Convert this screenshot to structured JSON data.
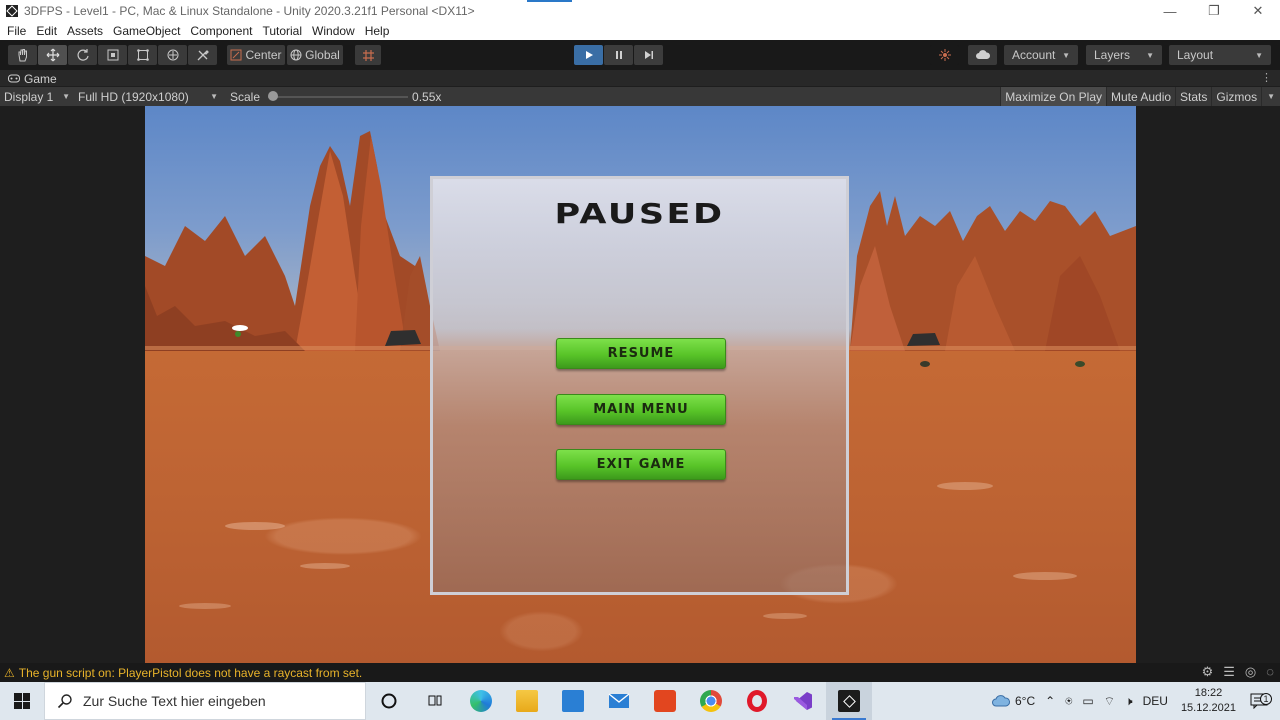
{
  "window": {
    "title": "3DFPS - Level1 - PC, Mac & Linux Standalone - Unity 2020.3.21f1 Personal <DX11>",
    "minimize": "—",
    "restore": "❐",
    "close": "✕"
  },
  "menu": [
    "File",
    "Edit",
    "Assets",
    "GameObject",
    "Component",
    "Tutorial",
    "Window",
    "Help"
  ],
  "toolbar": {
    "pivot_label": "Center",
    "space_label": "Global",
    "account_label": "Account",
    "layers_label": "Layers",
    "layout_label": "Layout"
  },
  "game_tab": {
    "label": "Game",
    "icon": "gamepad-icon"
  },
  "game_options": {
    "display": "Display 1",
    "resolution": "Full HD (1920x1080)",
    "scale_label": "Scale",
    "scale_value": "0.55x",
    "maximize_on_play": "Maximize On Play",
    "mute_audio": "Mute Audio",
    "stats": "Stats",
    "gizmos": "Gizmos"
  },
  "pause_menu": {
    "title": "PAUSED",
    "buttons": [
      "RESUME",
      "MAIN MENU",
      "EXIT GAME"
    ]
  },
  "console": {
    "warning": "The gun script on: PlayerPistol does not have a raycast from set."
  },
  "taskbar": {
    "search_placeholder": "Zur Suche Text hier eingeben",
    "weather": "6°C",
    "language": "DEU",
    "time": "18:22",
    "date": "15.12.2021",
    "notification_count": "1"
  },
  "colors": {
    "play_active": "#3a6ea5",
    "button_green": "#58c428",
    "warning_yellow": "#e8b32a"
  }
}
